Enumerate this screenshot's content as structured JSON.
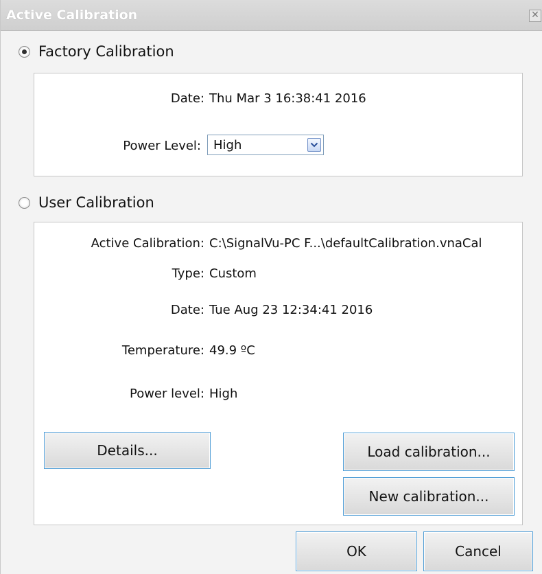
{
  "window": {
    "title": "Active Calibration",
    "close_symbol": "✕"
  },
  "factory": {
    "radio_label": "Factory Calibration",
    "selected": true,
    "date_label": "Date:",
    "date_value": "Thu Mar  3 16:38:41 2016",
    "power_label": "Power Level:",
    "power_value": "High"
  },
  "user": {
    "radio_label": "User Calibration",
    "selected": false,
    "fields": [
      {
        "label": "Active Calibration:",
        "value": "C:\\SignalVu-PC F...\\defaultCalibration.vnaCal"
      },
      {
        "label": "Type:",
        "value": "Custom"
      },
      {
        "label": "Date:",
        "value": "Tue Aug 23 12:34:41 2016"
      },
      {
        "label": "Temperature:",
        "value": "49.9 ºC"
      },
      {
        "label": "Power level:",
        "value": "High"
      }
    ],
    "details_button": "Details...",
    "load_button": "Load calibration...",
    "new_button": "New calibration..."
  },
  "footer": {
    "ok_button": "OK",
    "cancel_button": "Cancel"
  }
}
